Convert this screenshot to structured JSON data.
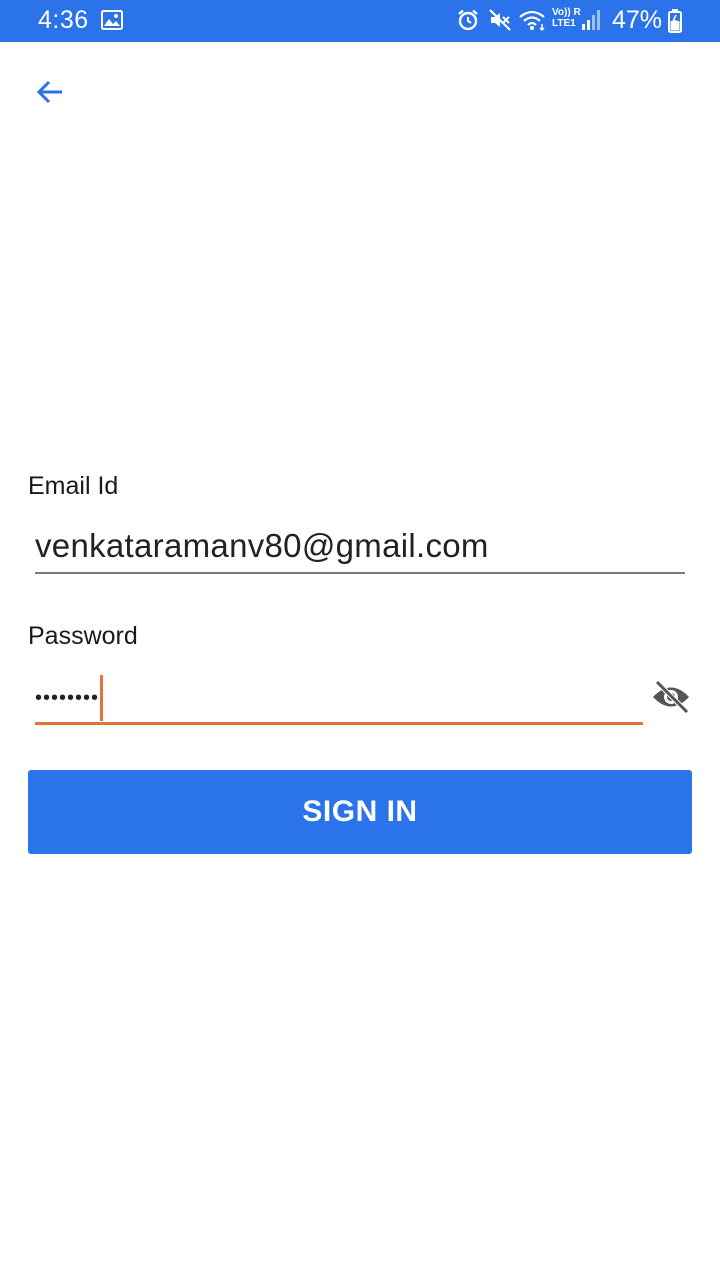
{
  "status_bar": {
    "time": "4:36",
    "battery_percent": "47%",
    "network_label_top": "Vo)) R",
    "network_label_bottom": "LTE1",
    "background_color": "#2a73ea",
    "icons": [
      "gallery-icon",
      "alarm-icon",
      "mute-icon",
      "wifi-icon",
      "volte-icon",
      "signal-icon",
      "battery-icon"
    ]
  },
  "nav": {
    "back_icon": "back-arrow-icon",
    "accent_color": "#2a73ea"
  },
  "form": {
    "email_label": "Email Id",
    "email_value": "venkataramanv80@gmail.com",
    "password_label": "Password",
    "password_value": "••••••••",
    "password_visibility_icon": "eye-off-icon",
    "focus_color": "#e2733a"
  },
  "actions": {
    "sign_in_label": "SIGN IN",
    "button_color": "#2a73ea"
  }
}
